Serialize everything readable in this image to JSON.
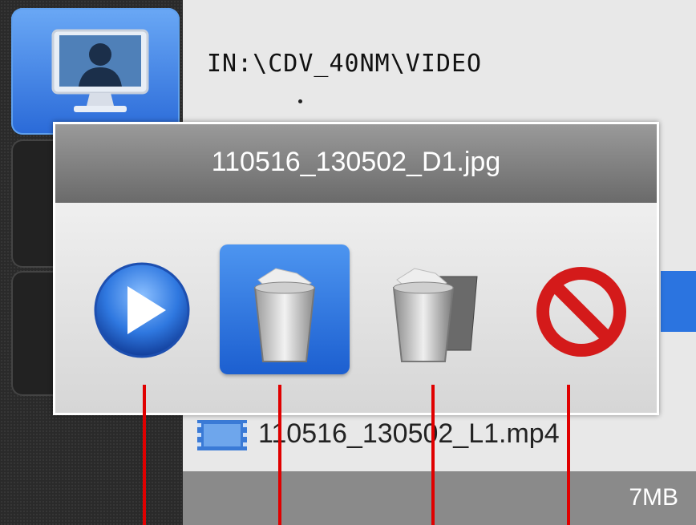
{
  "path_label": "IN:\\CDV_40NM\\VIDEO",
  "dialog": {
    "title": "110516_130502_D1.jpg",
    "actions": [
      {
        "name": "play",
        "icon": "play-icon"
      },
      {
        "name": "delete",
        "icon": "trash-icon",
        "selected": true
      },
      {
        "name": "delete-all",
        "icon": "trash-multiple-icon"
      },
      {
        "name": "cancel",
        "icon": "prohibited-icon"
      }
    ]
  },
  "file_list": [
    {
      "name": "110516_130502_L1.mp4",
      "icon": "film-icon"
    }
  ],
  "footer": {
    "size": "7MB"
  },
  "colors": {
    "accent": "#2b74e0",
    "marker": "#e00000",
    "title_bar": "#7a7a7a"
  }
}
